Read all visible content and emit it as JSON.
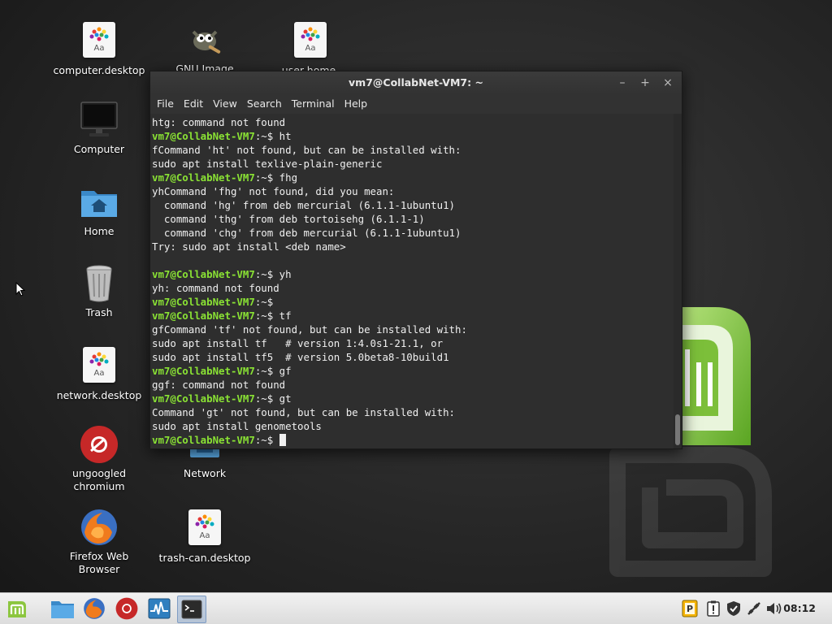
{
  "desktop": {
    "icons": [
      {
        "label": "computer.desktop",
        "icon": "font-file-icon"
      },
      {
        "label": "GNU Image",
        "icon": "gimp-icon"
      },
      {
        "label": "user-home.",
        "icon": "font-file-icon"
      },
      {
        "label": "Computer",
        "icon": "monitor-icon"
      },
      {
        "label": "Home",
        "icon": "home-folder-icon"
      },
      {
        "label": "Trash",
        "icon": "trash-icon"
      },
      {
        "label": "network.desktop",
        "icon": "font-file-icon"
      },
      {
        "label": "ungoogled chromium",
        "icon": "chromium-icon"
      },
      {
        "label": "Network",
        "icon": "network-icon"
      },
      {
        "label": "Firefox Web Browser",
        "icon": "firefox-icon"
      },
      {
        "label": "trash-can.desktop",
        "icon": "font-file-icon"
      }
    ],
    "font_file_glyph": "Aa"
  },
  "terminal": {
    "title": "vm7@CollabNet-VM7: ~",
    "window_buttons": {
      "minimize": "–",
      "maximize": "+",
      "close": "×"
    },
    "menu": [
      "File",
      "Edit",
      "View",
      "Search",
      "Terminal",
      "Help"
    ],
    "prompt_user": "vm7@CollabNet-VM7",
    "prompt_suffix": ":~$ ",
    "lines": [
      {
        "type": "out",
        "text": "htg: command not found"
      },
      {
        "type": "prompt",
        "text": "ht"
      },
      {
        "type": "out",
        "text": "fCommand 'ht' not found, but can be installed with:"
      },
      {
        "type": "out",
        "text": "sudo apt install texlive-plain-generic"
      },
      {
        "type": "prompt",
        "text": "fhg"
      },
      {
        "type": "out",
        "text": "yhCommand 'fhg' not found, did you mean:"
      },
      {
        "type": "out",
        "text": "  command 'hg' from deb mercurial (6.1.1-1ubuntu1)"
      },
      {
        "type": "out",
        "text": "  command 'thg' from deb tortoisehg (6.1.1-1)"
      },
      {
        "type": "out",
        "text": "  command 'chg' from deb mercurial (6.1.1-1ubuntu1)"
      },
      {
        "type": "out",
        "text": "Try: sudo apt install <deb name>"
      },
      {
        "type": "out",
        "text": ""
      },
      {
        "type": "prompt",
        "text": "yh"
      },
      {
        "type": "out",
        "text": "yh: command not found"
      },
      {
        "type": "prompt",
        "text": ""
      },
      {
        "type": "prompt",
        "text": "tf"
      },
      {
        "type": "out",
        "text": "gfCommand 'tf' not found, but can be installed with:"
      },
      {
        "type": "out",
        "text": "sudo apt install tf   # version 1:4.0s1-21.1, or"
      },
      {
        "type": "out",
        "text": "sudo apt install tf5  # version 5.0beta8-10build1"
      },
      {
        "type": "prompt",
        "text": "gf"
      },
      {
        "type": "out",
        "text": "ggf: command not found"
      },
      {
        "type": "prompt",
        "text": "gt"
      },
      {
        "type": "out",
        "text": "Command 'gt' not found, but can be installed with:"
      },
      {
        "type": "out",
        "text": "sudo apt install genometools"
      },
      {
        "type": "prompt-active",
        "text": ""
      }
    ]
  },
  "taskbar": {
    "launchers": [
      "mint-menu-icon",
      "files-icon",
      "firefox-icon",
      "chromium-icon",
      "system-monitor-icon",
      "terminal-icon"
    ],
    "tray": [
      "parking-icon",
      "clipboard-alert-icon",
      "shield-icon",
      "network-icon",
      "volume-icon"
    ],
    "clock": "08:12"
  },
  "colors": {
    "prompt_green": "#8ae234",
    "mint_green": "#8cc63f"
  }
}
